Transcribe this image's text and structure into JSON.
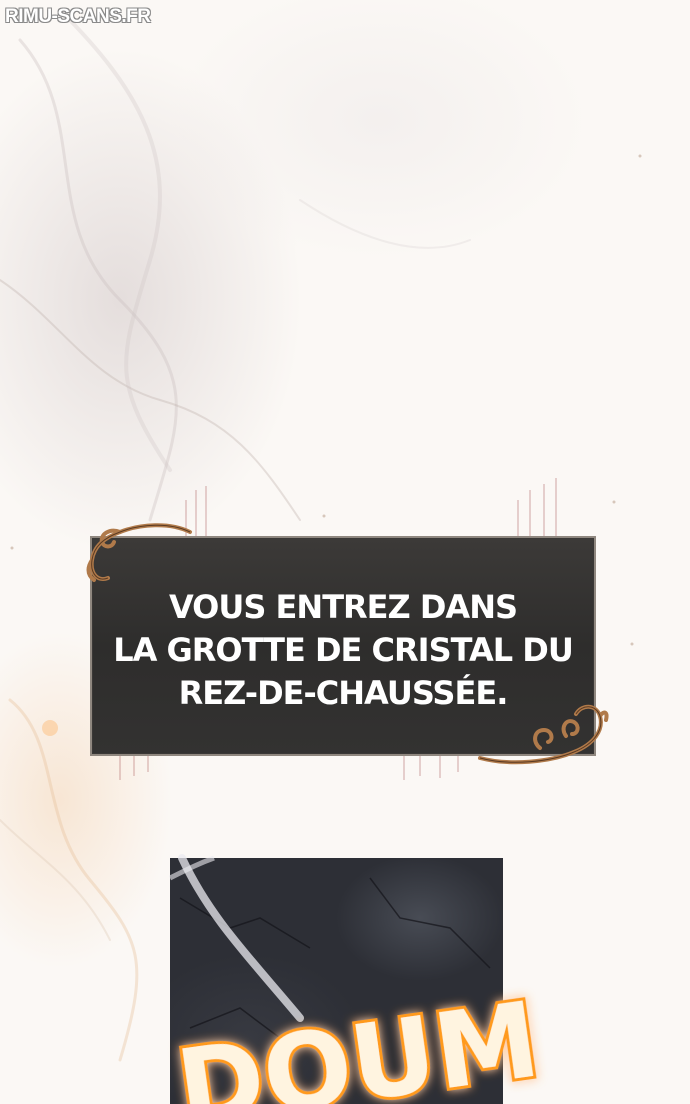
{
  "watermark": "RIMU-SCANS.FR",
  "notification": {
    "line1": "VOUS ENTREZ DANS",
    "line2": "LA GROTTE DE CRISTAL DU",
    "line3": "REZ-DE-CHAUSSÉE."
  },
  "sfx": "DOUM",
  "colors": {
    "box_bg": "#333231",
    "box_border": "#8f877f",
    "ornament": "#b07a4a",
    "sfx_glow": "#ff9a1f"
  }
}
